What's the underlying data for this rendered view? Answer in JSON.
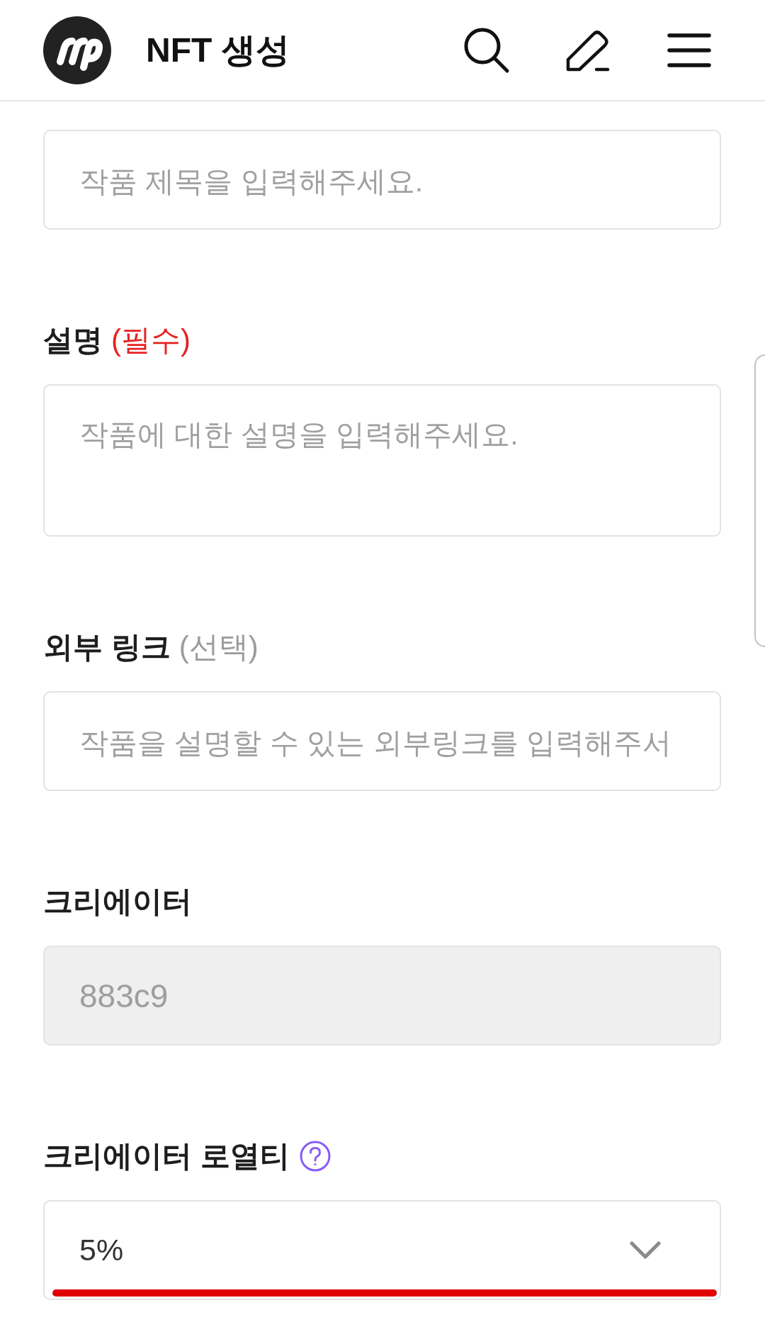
{
  "header": {
    "title": "NFT 생성"
  },
  "fields": [
    {
      "kind": "text",
      "placeholder": "작품 제목을 입력해주세요.",
      "disabled": false,
      "help": false,
      "highlighted": false
    },
    {
      "kind": "textarea",
      "label": "설명",
      "tag": {
        "text": "(필수)",
        "kind": "required"
      },
      "placeholder": "작품에 대한 설명을 입력해주세요.",
      "disabled": false,
      "help": false,
      "highlighted": false
    },
    {
      "kind": "text",
      "label": "외부 링크",
      "tag": {
        "text": "(선택)",
        "kind": "optional"
      },
      "placeholder": "작품을 설명할 수 있는 외부링크를 입력해주서",
      "disabled": false,
      "help": false,
      "highlighted": false
    },
    {
      "kind": "text",
      "label": "크리에이터",
      "value": "883c9",
      "disabled": true,
      "help": false,
      "highlighted": false
    },
    {
      "kind": "select",
      "label": "크리에이터 로열티",
      "value": "5%",
      "disabled": false,
      "help": true,
      "highlighted": true
    }
  ]
}
